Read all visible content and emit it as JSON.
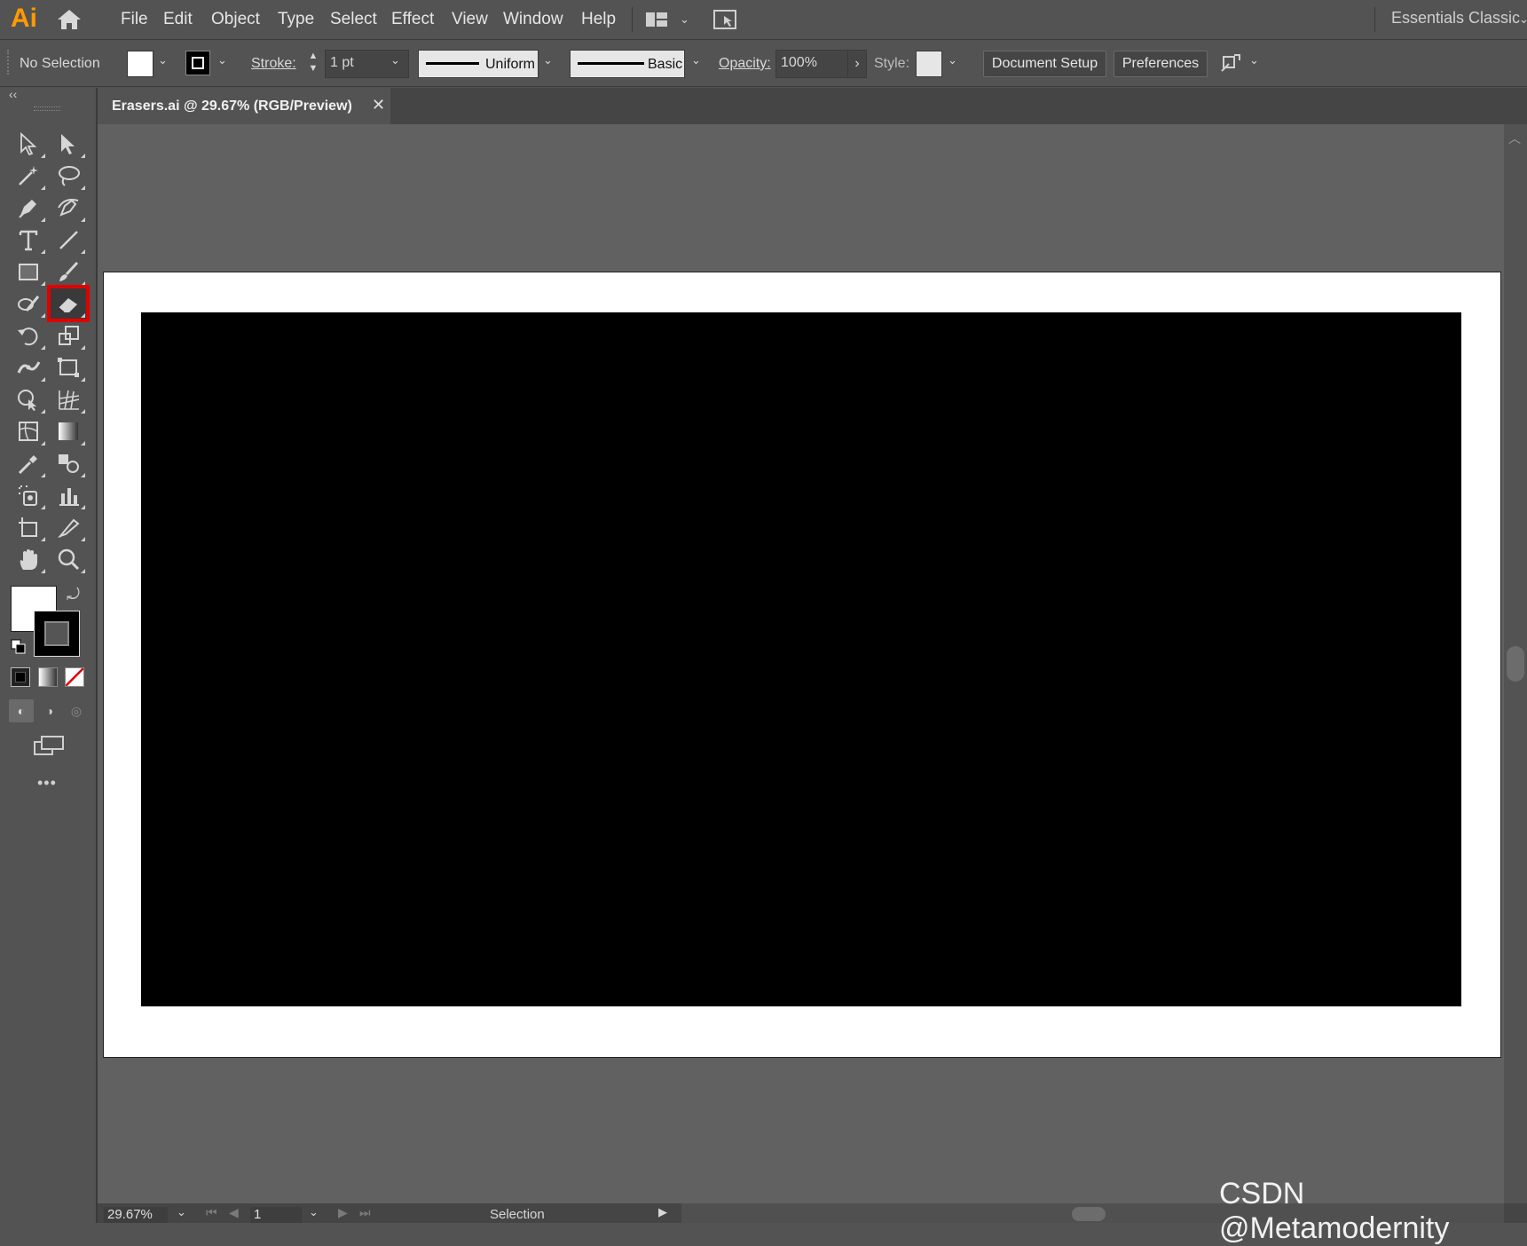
{
  "app": {
    "logo": "Ai"
  },
  "menu": [
    "File",
    "Edit",
    "Object",
    "Type",
    "Select",
    "Effect",
    "View",
    "Window",
    "Help"
  ],
  "workspace": {
    "name": "Essentials Classic"
  },
  "control_bar": {
    "selection": "No Selection",
    "stroke_label": "Stroke:",
    "stroke_value": "1 pt",
    "profile": "Uniform",
    "brush": "Basic",
    "opacity_label": "Opacity:",
    "opacity_value": "100%",
    "style_label": "Style:",
    "document_setup": "Document Setup",
    "preferences": "Preferences"
  },
  "document_tab": {
    "title": "Erasers.ai @ 29.67% (RGB/Preview)",
    "close": "✕"
  },
  "toolbar": {
    "collapse": "‹‹",
    "tools": [
      "selection-tool",
      "direct-selection-tool",
      "magic-wand-tool",
      "lasso-tool",
      "pen-tool",
      "curvature-tool",
      "type-tool",
      "line-segment-tool",
      "rectangle-tool",
      "paintbrush-tool",
      "shaper-tool",
      "eraser-tool",
      "rotate-tool",
      "scale-tool",
      "width-tool",
      "free-transform-tool",
      "shape-builder-tool",
      "perspective-grid-tool",
      "mesh-tool",
      "gradient-tool",
      "eyedropper-tool",
      "blend-tool",
      "symbol-sprayer-tool",
      "column-graph-tool",
      "artboard-tool",
      "slice-tool",
      "hand-tool",
      "zoom-tool"
    ],
    "selected_tool": "eraser-tool",
    "highlight_color": "#e00000",
    "more": "•••"
  },
  "status_bar": {
    "zoom": "29.67%",
    "artboard_number": "1",
    "mode": "Selection"
  },
  "colors": {
    "fill": "#ffffff",
    "stroke": "#000000",
    "artboard_fill": "#000000"
  },
  "watermark": "CSDN @Metamodernity"
}
